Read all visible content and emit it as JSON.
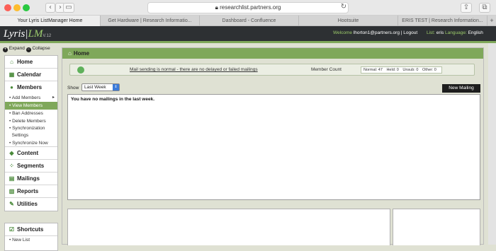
{
  "browser": {
    "url": "researchlist.partners.org",
    "tabs": [
      "Your Lyris ListManager Home",
      "Get Hardware | Research Informatio...",
      "Dashboard - Confluence",
      "Hootsuite",
      "ERIS TEST | Research Information...",
      "+"
    ]
  },
  "header": {
    "logo_main": "Lyris|",
    "logo_lm": "LM",
    "logo_ver": "V.12",
    "welcome_label": "Welcome",
    "user": "lhorton1@partners.org",
    "separator": " | ",
    "logout": "Logout",
    "list_label": "List:",
    "list_value": "eris",
    "language_label": "Language:",
    "language_value": "English"
  },
  "sidebar": {
    "expand": "Expand",
    "collapse": "Collapse",
    "nav": {
      "home": "Home",
      "calendar": "Calendar",
      "members": "Members",
      "content": "Content",
      "segments": "Segments",
      "mailings": "Mailings",
      "reports": "Reports",
      "utilities": "Utilities"
    },
    "members_sub": {
      "add": "Add Members",
      "view": "View Members",
      "ban": "Ban Addresses",
      "delete": "Delete Members",
      "sync_settings_1": "Synchronization",
      "sync_settings_2": "Settings",
      "sync_now": "Synchronize Now"
    },
    "shortcuts": {
      "title": "Shortcuts",
      "new_list": "New List"
    }
  },
  "main": {
    "title": "Home",
    "status_message": "Mail sending is normal - there are no delayed or failed mailings",
    "member_count_label": "Member Count",
    "counts": {
      "normal": "Normal: 47",
      "held": "Held: 0",
      "unsub": "Unsub: 0",
      "other": "Other: 0"
    },
    "show_label": "Show",
    "show_value": "Last Week",
    "new_mailing": "New Mailing",
    "no_mailings": "You have no mailings in the last week."
  }
}
